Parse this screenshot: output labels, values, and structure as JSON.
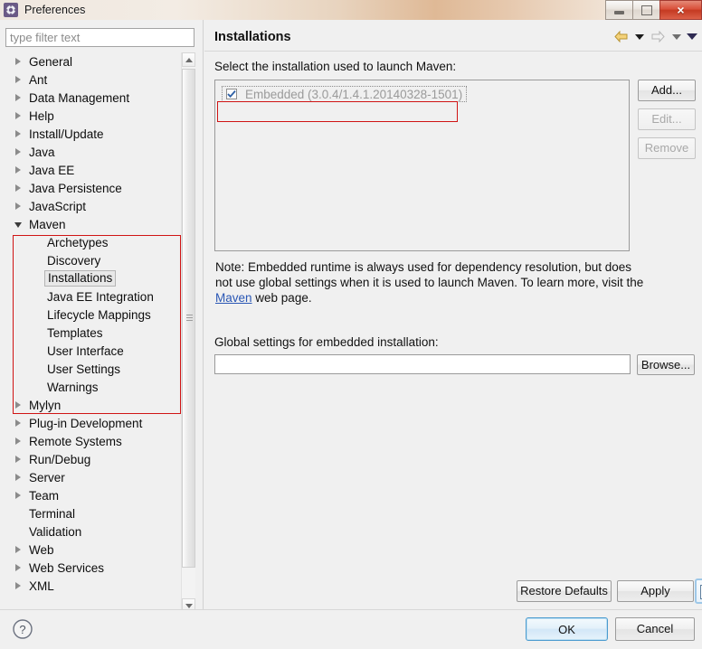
{
  "window": {
    "title": "Preferences",
    "icon": "gear-icon",
    "controls": {
      "minimize": "minimize-icon",
      "maximize": "maximize-icon",
      "close": "×"
    }
  },
  "sidebar": {
    "filter": {
      "placeholder": "type filter text",
      "value": ""
    },
    "items": [
      {
        "label": "General",
        "state": "collapsed",
        "level": 0
      },
      {
        "label": "Ant",
        "state": "collapsed",
        "level": 0
      },
      {
        "label": "Data Management",
        "state": "collapsed",
        "level": 0
      },
      {
        "label": "Help",
        "state": "collapsed",
        "level": 0
      },
      {
        "label": "Install/Update",
        "state": "collapsed",
        "level": 0
      },
      {
        "label": "Java",
        "state": "collapsed",
        "level": 0
      },
      {
        "label": "Java EE",
        "state": "collapsed",
        "level": 0
      },
      {
        "label": "Java Persistence",
        "state": "collapsed",
        "level": 0
      },
      {
        "label": "JavaScript",
        "state": "collapsed",
        "level": 0
      },
      {
        "label": "Maven",
        "state": "expanded",
        "level": 0
      },
      {
        "label": "Archetypes",
        "state": "leaf",
        "level": 1
      },
      {
        "label": "Discovery",
        "state": "leaf",
        "level": 1
      },
      {
        "label": "Installations",
        "state": "leaf",
        "level": 1,
        "selected": true
      },
      {
        "label": "Java EE Integration",
        "state": "leaf",
        "level": 1
      },
      {
        "label": "Lifecycle Mappings",
        "state": "leaf",
        "level": 1
      },
      {
        "label": "Templates",
        "state": "leaf",
        "level": 1
      },
      {
        "label": "User Interface",
        "state": "leaf",
        "level": 1
      },
      {
        "label": "User Settings",
        "state": "leaf",
        "level": 1
      },
      {
        "label": "Warnings",
        "state": "leaf",
        "level": 1
      },
      {
        "label": "Mylyn",
        "state": "collapsed",
        "level": 0
      },
      {
        "label": "Plug-in Development",
        "state": "collapsed",
        "level": 0
      },
      {
        "label": "Remote Systems",
        "state": "collapsed",
        "level": 0
      },
      {
        "label": "Run/Debug",
        "state": "collapsed",
        "level": 0
      },
      {
        "label": "Server",
        "state": "collapsed",
        "level": 0
      },
      {
        "label": "Team",
        "state": "collapsed",
        "level": 0
      },
      {
        "label": "Terminal",
        "state": "leaf-root",
        "level": 0
      },
      {
        "label": "Validation",
        "state": "leaf-root",
        "level": 0
      },
      {
        "label": "Web",
        "state": "collapsed",
        "level": 0
      },
      {
        "label": "Web Services",
        "state": "collapsed",
        "level": 0
      },
      {
        "label": "XML",
        "state": "collapsed",
        "level": 0
      }
    ]
  },
  "main": {
    "title": "Installations",
    "nav": {
      "back": "back-arrow-icon",
      "back_menu": "chevron-down-icon",
      "forward": "forward-arrow-icon",
      "forward_menu": "chevron-down-icon",
      "view_menu": "view-menu-icon"
    },
    "select_label": "Select the installation used to launch Maven:",
    "installations": [
      {
        "checked": true,
        "label": "Embedded (3.0.4/1.4.1.20140328-1501)",
        "focused": true,
        "disabled": true
      }
    ],
    "side_buttons": [
      {
        "label": "Add...",
        "enabled": true
      },
      {
        "label": "Edit...",
        "enabled": false
      },
      {
        "label": "Remove",
        "enabled": false
      }
    ],
    "note": {
      "part1": "Note: Embedded runtime is always used for dependency resolution, but does not use global settings when it is used to launch Maven. To learn more, visit the ",
      "link": "Maven",
      "part2": " web page."
    },
    "global_settings": {
      "label": "Global settings for embedded installation:",
      "value": "",
      "placeholder": "",
      "browse_label": "Browse..."
    },
    "bottom_buttons": {
      "restore": "Restore Defaults",
      "apply": "Apply"
    }
  },
  "footer": {
    "help": "help-icon",
    "ok": "OK",
    "cancel": "Cancel"
  },
  "colors": {
    "annotation": "#d01414",
    "link": "#2a57b5",
    "accent": "#4b9bcf"
  }
}
